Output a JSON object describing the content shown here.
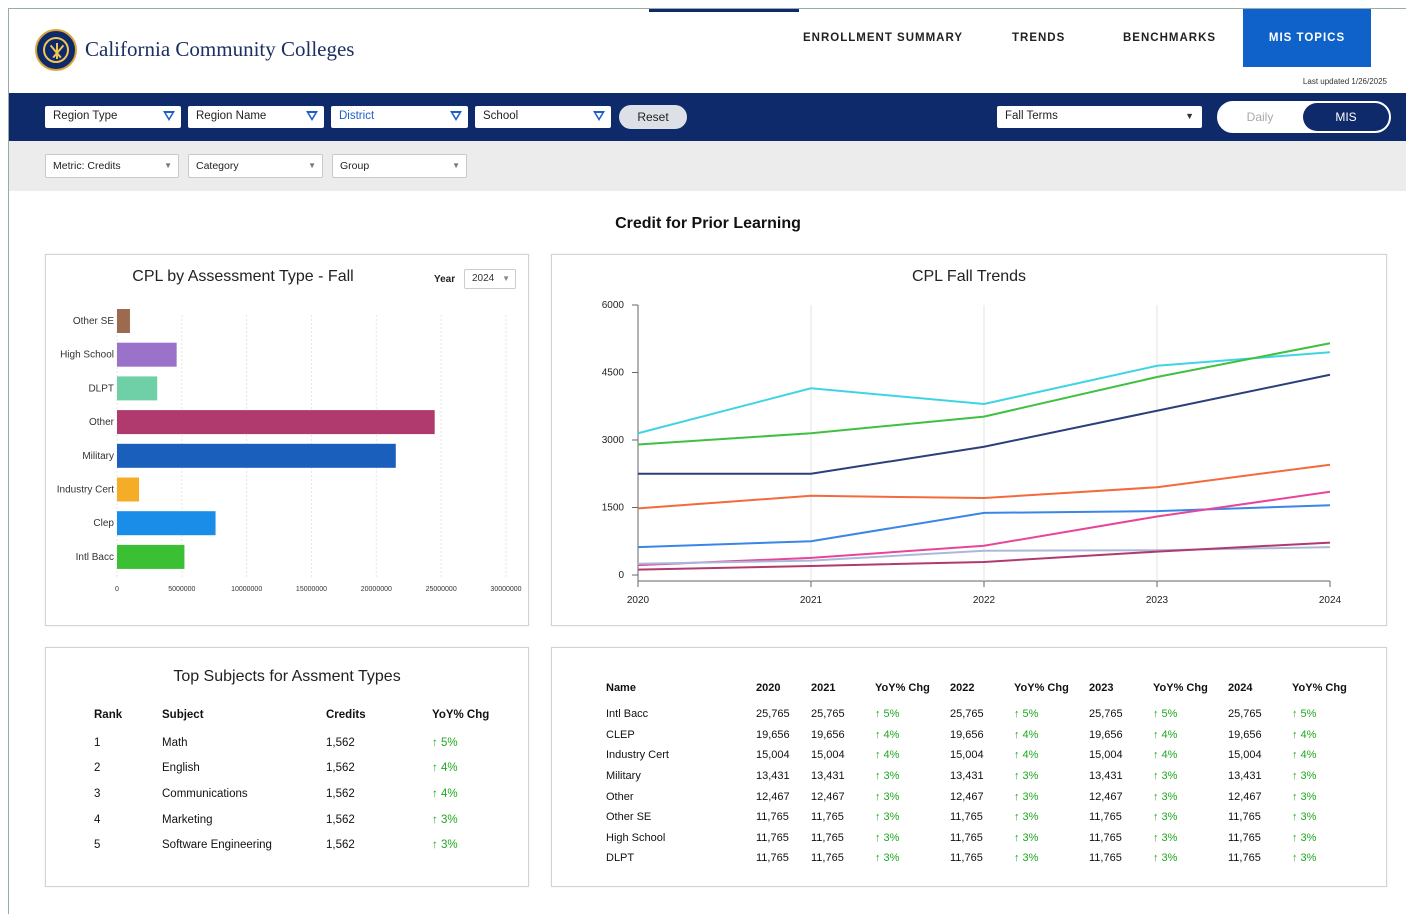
{
  "brand": "California Community Colleges",
  "nav": [
    {
      "label": "ENROLLMENT SUMMARY"
    },
    {
      "label": "TRENDS"
    },
    {
      "label": "BENCHMARKS"
    },
    {
      "label": "MIS TOPICS"
    }
  ],
  "last_updated": "Last updated 1/26/2025",
  "filters": {
    "region_type": "Region Type",
    "region_name": "Region Name",
    "district": "District",
    "school": "School",
    "reset": "Reset",
    "terms": "Fall Terms",
    "toggle_daily": "Daily",
    "toggle_mis": "MIS",
    "metric": "Metric: Credits",
    "category": "Category",
    "group": "Group"
  },
  "section_title": "Credit for Prior Learning",
  "colors": {
    "navy": "#0e2a6b",
    "nav_active": "#0f62c9",
    "up": "#1fa81f"
  },
  "bar_panel": {
    "title": "CPL by Assessment Type - Fall",
    "year_label": "Year",
    "year_value": "2024"
  },
  "line_panel": {
    "title": "CPL Fall Trends"
  },
  "chart_data": [
    {
      "type": "bar",
      "orientation": "horizontal",
      "title": "CPL by Assessment Type - Fall",
      "categories": [
        "Other SE",
        "High School",
        "DLPT",
        "Other",
        "Military",
        "Industry Cert",
        "Clep",
        "Intl Bacc"
      ],
      "values": [
        1000000,
        4600000,
        3100000,
        24500000,
        21500000,
        1700000,
        7600000,
        5200000
      ],
      "colors": [
        "#9c6b4f",
        "#9b72c9",
        "#6fd0a8",
        "#b03a6e",
        "#1b5fbd",
        "#f5ad28",
        "#1a8de8",
        "#3bbf33"
      ],
      "xticks": [
        0,
        5000000,
        10000000,
        15000000,
        20000000,
        25000000,
        30000000
      ],
      "xlim": [
        0,
        30000000
      ],
      "grid": true,
      "legend": "none"
    },
    {
      "type": "line",
      "title": "CPL Fall Trends",
      "x": [
        2020,
        2021,
        2022,
        2023,
        2024
      ],
      "ylim": [
        0,
        6000
      ],
      "yticks": [
        0,
        1500,
        3000,
        4500,
        6000
      ],
      "grid": true,
      "legend": "none",
      "series": [
        {
          "color": "#3fd4e4",
          "values": [
            3150,
            4150,
            3800,
            4650,
            4950
          ]
        },
        {
          "color": "#40c040",
          "values": [
            2900,
            3150,
            3520,
            4400,
            5150
          ]
        },
        {
          "color": "#2b3f7a",
          "values": [
            2250,
            2250,
            2850,
            3650,
            4450
          ]
        },
        {
          "color": "#f46a3c",
          "values": [
            1480,
            1760,
            1710,
            1950,
            2450
          ]
        },
        {
          "color": "#3a86e8",
          "values": [
            620,
            750,
            1380,
            1420,
            1550
          ]
        },
        {
          "color": "#e8459a",
          "values": [
            220,
            380,
            650,
            1300,
            1850
          ]
        },
        {
          "color": "#aab8dc",
          "values": [
            250,
            320,
            540,
            550,
            620
          ]
        },
        {
          "color": "#b03a6e",
          "values": [
            120,
            200,
            290,
            520,
            720
          ]
        }
      ]
    }
  ],
  "subjects": {
    "title": "Top Subjects for Assment Types",
    "headers": [
      "Rank",
      "Subject",
      "Credits",
      "YoY% Chg"
    ],
    "rows": [
      {
        "rank": "1",
        "subject": "Math",
        "credits": "1,562",
        "chg": "↑ 5%"
      },
      {
        "rank": "2",
        "subject": "English",
        "credits": "1,562",
        "chg": "↑ 4%"
      },
      {
        "rank": "3",
        "subject": "Communications",
        "credits": "1,562",
        "chg": "↑ 4%"
      },
      {
        "rank": "4",
        "subject": "Marketing",
        "credits": "1,562",
        "chg": "↑ 3%"
      },
      {
        "rank": "5",
        "subject": "Software Engineering",
        "credits": "1,562",
        "chg": "↑ 3%"
      }
    ]
  },
  "detail_table": {
    "headers": [
      "Name",
      "2020",
      "2021",
      "YoY% Chg",
      "2022",
      "YoY% Chg",
      "2023",
      "YoY% Chg",
      "2024",
      "YoY% Chg"
    ],
    "rows": [
      [
        "Intl Bacc",
        "25,765",
        "25,765",
        "↑ 5%",
        "25,765",
        "↑ 5%",
        "25,765",
        "↑ 5%",
        "25,765",
        "↑ 5%"
      ],
      [
        "CLEP",
        "19,656",
        "19,656",
        "↑ 4%",
        "19,656",
        "↑ 4%",
        "19,656",
        "↑ 4%",
        "19,656",
        "↑ 4%"
      ],
      [
        "Industry Cert",
        "15,004",
        "15,004",
        "↑ 4%",
        "15,004",
        "↑ 4%",
        "15,004",
        "↑ 4%",
        "15,004",
        "↑ 4%"
      ],
      [
        "Military",
        "13,431",
        "13,431",
        "↑ 3%",
        "13,431",
        "↑ 3%",
        "13,431",
        "↑ 3%",
        "13,431",
        "↑ 3%"
      ],
      [
        "Other",
        "12,467",
        "12,467",
        "↑ 3%",
        "12,467",
        "↑ 3%",
        "12,467",
        "↑ 3%",
        "12,467",
        "↑ 3%"
      ],
      [
        "Other SE",
        "11,765",
        "11,765",
        "↑ 3%",
        "11,765",
        "↑ 3%",
        "11,765",
        "↑ 3%",
        "11,765",
        "↑ 3%"
      ],
      [
        "High School",
        "11,765",
        "11,765",
        "↑ 3%",
        "11,765",
        "↑ 3%",
        "11,765",
        "↑ 3%",
        "11,765",
        "↑ 3%"
      ],
      [
        "DLPT",
        "11,765",
        "11,765",
        "↑ 3%",
        "11,765",
        "↑ 3%",
        "11,765",
        "↑ 3%",
        "11,765",
        "↑ 3%"
      ]
    ]
  }
}
